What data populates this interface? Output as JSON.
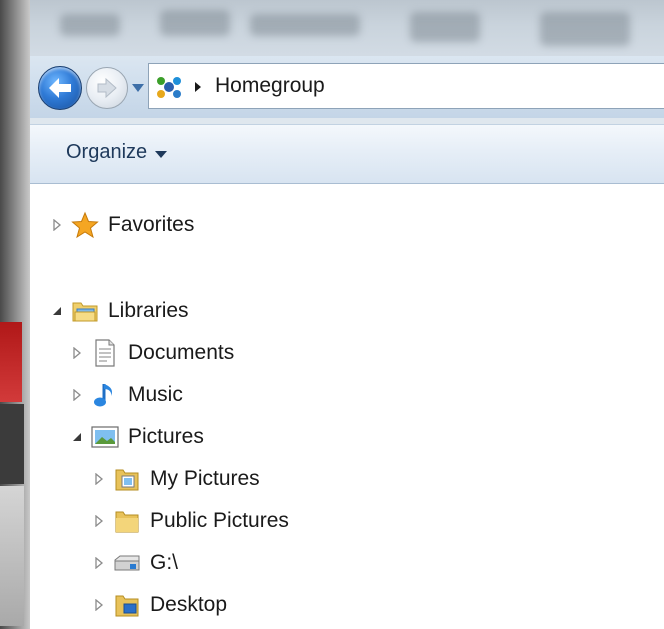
{
  "address_bar": {
    "location": "Homegroup"
  },
  "command_bar": {
    "organize_label": "Organize"
  },
  "nav_tree": {
    "favorites": "Favorites",
    "libraries": "Libraries",
    "documents": "Documents",
    "music": "Music",
    "pictures": "Pictures",
    "my_pictures": "My Pictures",
    "public_pictures": "Public Pictures",
    "g_drive": "G:\\",
    "desktop": "Desktop"
  },
  "icons": {
    "back": "back-arrow-icon",
    "forward": "forward-arrow-icon",
    "recent": "recent-pages-icon",
    "homegroup": "homegroup-icon",
    "favorites": "star-icon",
    "libraries": "libraries-folder-icon",
    "documents": "document-icon",
    "music": "music-note-icon",
    "pictures": "picture-icon",
    "folder": "folder-icon",
    "drive": "drive-icon"
  },
  "colors": {
    "accent": "#2f7ad6",
    "star": "#f5a623"
  }
}
